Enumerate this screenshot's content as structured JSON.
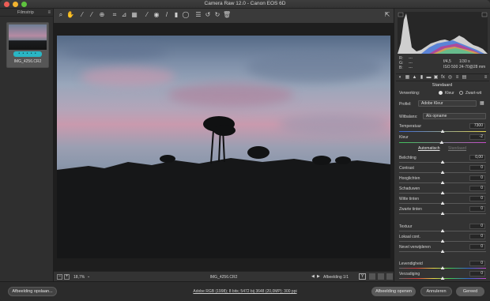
{
  "window": {
    "title": "Camera Raw 12.0  -  Canon EOS 6D"
  },
  "filmstrip": {
    "label": "Filmstrip",
    "thumbnail": {
      "name": "IMG_4256.CR2",
      "stars": "• • • • •"
    }
  },
  "toolbar": {
    "tools": [
      "zoom-icon",
      "hand-icon",
      "white-balance-icon",
      "color-sampler-icon",
      "targeted-adjustment-icon",
      "crop-icon",
      "straighten-icon",
      "transform-icon",
      "spot-removal-icon",
      "red-eye-icon",
      "adjustment-brush-icon",
      "graduated-filter-icon",
      "radial-filter-icon",
      "preferences-icon",
      "rotate-left-icon",
      "rotate-right-icon",
      "trash-icon"
    ],
    "export_icon": "open-in-icon"
  },
  "statusbar": {
    "zoom": "18,7%",
    "filename": "IMG_4256.CR2",
    "image_count": "Afbeelding 1/1"
  },
  "histogram": {
    "r": "R:",
    "g": "G:",
    "b": "B:",
    "rv": "---",
    "gv": "---",
    "bv": "---",
    "aperture": "f/4,5",
    "shutter": "1/30 s",
    "iso": "ISO 500",
    "lens": "24-70@28 mm"
  },
  "panel": {
    "section": "Standaard",
    "processing_label": "Verwerking:",
    "color_option": "Kleur",
    "bw_option": "Zwart-wit",
    "profile_label": "Profiel:",
    "profile_value": "Adobe Kleur",
    "wb_label": "Witbalans:",
    "wb_value": "Als opname",
    "temperature": {
      "label": "Temperatuur",
      "value": "7300",
      "pos": 0.5
    },
    "tint": {
      "label": "Kleur",
      "value": "-2",
      "pos": 0.49
    },
    "auto": "Automatisch",
    "default": "Standaard",
    "sliders": [
      {
        "label": "Belichting",
        "value": "0,00",
        "pos": 0.5
      },
      {
        "label": "Contrast",
        "value": "0",
        "pos": 0.5
      },
      {
        "label": "Hooglichten",
        "value": "0",
        "pos": 0.5
      },
      {
        "label": "Schaduwen",
        "value": "0",
        "pos": 0.5
      },
      {
        "label": "Witte tinten",
        "value": "0",
        "pos": 0.5
      },
      {
        "label": "Zwarte tinten",
        "value": "0",
        "pos": 0.5
      },
      {
        "label": "Textuur",
        "value": "0",
        "pos": 0.5
      },
      {
        "label": "Lokaal cont.",
        "value": "0",
        "pos": 0.5
      },
      {
        "label": "Nevel verwijderen",
        "value": "0",
        "pos": 0.5
      },
      {
        "label": "Levendigheid",
        "value": "0",
        "pos": 0.5
      },
      {
        "label": "Verzadiging",
        "value": "0",
        "pos": 0.5
      }
    ]
  },
  "bottom": {
    "save": "Afbeelding opslaan...",
    "workflow": "Adobe RGB (1998); 8 bits; 5472 bij 3648 (20,0MP); 300 ppi",
    "open": "Afbeelding openen",
    "cancel": "Annuleren",
    "done": "Gereed"
  },
  "colors": {
    "accent": "#2ab6c4"
  }
}
